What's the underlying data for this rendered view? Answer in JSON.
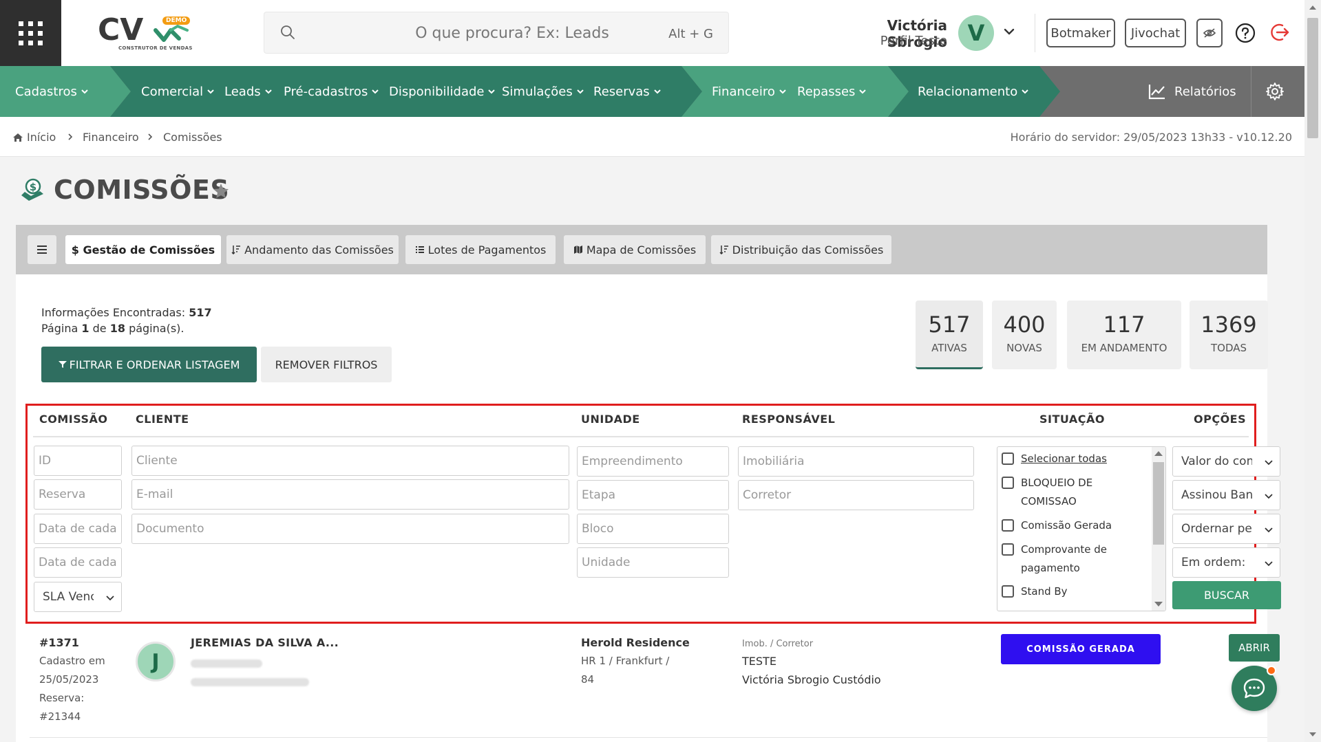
{
  "header": {
    "logo_text": "CV",
    "logo_badge": "DEMO",
    "logo_subtitle": "CONSTRUTOR DE VENDAS",
    "search_placeholder": "O que procura? Ex: Leads",
    "search_shortcut": "Alt + G",
    "user_name": "Victória Sbrogio",
    "user_profile": "Perfil Teste",
    "avatar_letter": "V",
    "botmaker_label": "Botmaker",
    "jivochat_label": "Jivochat",
    "icons": [
      "apps-icon",
      "search-icon",
      "chevron-down-icon",
      "eye-off-icon",
      "help-icon",
      "logout-icon"
    ]
  },
  "nav": {
    "items": [
      {
        "label": "Cadastros"
      },
      {
        "label": "Comercial"
      },
      {
        "label": "Leads"
      },
      {
        "label": "Pré-cadastros"
      },
      {
        "label": "Disponibilidade"
      },
      {
        "label": "Simulações"
      },
      {
        "label": "Reservas"
      },
      {
        "label": "Financeiro"
      },
      {
        "label": "Repasses"
      },
      {
        "label": "Relacionamento"
      }
    ],
    "reports_label": "Relatórios",
    "colors": {
      "green_dark": "#2f7d66",
      "green_light": "#4aa27f",
      "gray": "#6e6e6e"
    }
  },
  "breadcrumb": {
    "items": [
      "Início",
      "Financeiro",
      "Comissões"
    ],
    "server_time": "Horário do servidor: 29/05/2023 13h33 - v10.12.20"
  },
  "page": {
    "title": "COMISSÕES"
  },
  "tabs": [
    {
      "label": "$ Gestão de Comissões"
    },
    {
      "label": "Andamento das Comissões"
    },
    {
      "label": "Lotes de Pagamentos"
    },
    {
      "label": "Mapa de Comissões"
    },
    {
      "label": "Distribuição das Comissões"
    }
  ],
  "info": {
    "found_label": "Informações Encontradas:",
    "found_count": "517",
    "page_label": "Página",
    "page_current": "1",
    "page_of": "de",
    "page_total": "18",
    "page_suffix": "página(s)."
  },
  "buttons": {
    "filter_label": "FILTRAR E ORDENAR LISTAGEM",
    "remove_label": "REMOVER FILTROS",
    "buscar_label": "BUSCAR"
  },
  "stats": [
    {
      "value": "517",
      "label": "ATIVAS"
    },
    {
      "value": "400",
      "label": "NOVAS"
    },
    {
      "value": "117",
      "label": "EM ANDAMENTO"
    },
    {
      "value": "1369",
      "label": "TODAS"
    }
  ],
  "table": {
    "headers": [
      "COMISSÃO",
      "CLIENTE",
      "UNIDADE",
      "RESPONSÁVEL",
      "SITUAÇÃO",
      "OPÇÕES"
    ],
    "filters": {
      "id": "ID",
      "reserva": "Reserva",
      "data1": "Data de cadastro",
      "data2": "Data de cadastro",
      "sla": "SLA Vencido",
      "cliente": "Cliente",
      "email": "E-mail",
      "documento": "Documento",
      "empreendimento": "Empreendimento",
      "etapa": "Etapa",
      "bloco": "Bloco",
      "unidade": "Unidade",
      "imobiliaria": "Imobiliária",
      "corretor": "Corretor"
    },
    "situacao": [
      {
        "label": "Selecionar todas"
      },
      {
        "label": "BLOQUEIO DE COMISSAO"
      },
      {
        "label": "Comissão Gerada"
      },
      {
        "label": "Comprovante de pagamento"
      },
      {
        "label": "Stand By"
      }
    ],
    "opcoes": [
      "Valor do contrato",
      "Assinou Banco",
      "Ordernar pelo",
      "Em ordem:"
    ]
  },
  "row": {
    "id": "#1371",
    "cadastro_label": "Cadastro em",
    "cadastro_date": "25/05/2023",
    "reserva_label": "Reserva:",
    "reserva_id": "#21344",
    "avatar_letter": "J",
    "client_name": "JEREMIAS DA SILVA A...",
    "empreendimento": "Herold Residence",
    "unit_line1": "HR 1 / Frankfurt /",
    "unit_line2": "84",
    "resp_label": "Imob. / Corretor",
    "imobiliaria": "TESTE",
    "corretor": "Victória Sbrogio Custódio",
    "status": "COMISSÃO GERADA",
    "status_color": "#2f0ff0",
    "open_label": "ABRIR"
  }
}
